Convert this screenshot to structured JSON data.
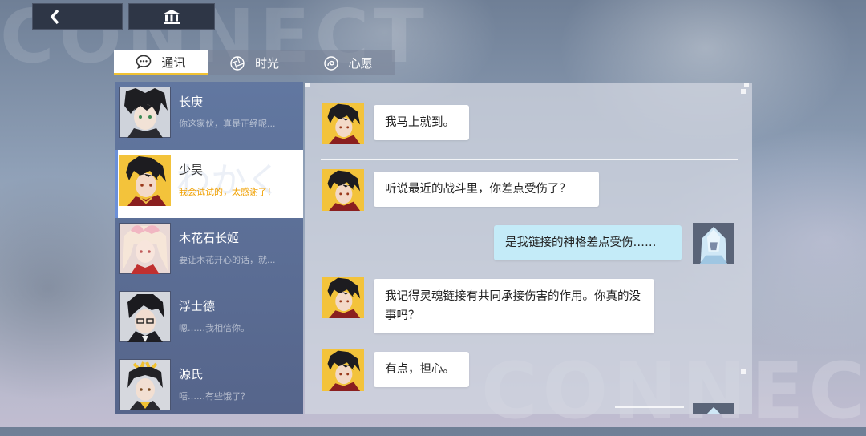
{
  "background": {
    "watermark": "CONNECT"
  },
  "nav": {
    "back_icon": "back-chevron-icon",
    "home_icon": "museum-icon"
  },
  "tabs": [
    {
      "label": "通讯",
      "icon": "chat-bubble-icon",
      "active": true
    },
    {
      "label": "时光",
      "icon": "aperture-icon",
      "active": false
    },
    {
      "label": "心愿",
      "icon": "swirl-icon",
      "active": false
    }
  ],
  "contacts": [
    {
      "name": "长庚",
      "preview": "你这家伙，真是正经呢...",
      "selected": false
    },
    {
      "name": "少昊",
      "preview": "我会试试的，太感谢了！",
      "selected": true
    },
    {
      "name": "木花石长姬",
      "preview": "要让木花开心的话，就...",
      "selected": false
    },
    {
      "name": "浮士德",
      "preview": "嗯……我相信你。",
      "selected": false
    },
    {
      "name": "源氏",
      "preview": "唔……有些饿了？",
      "selected": false
    }
  ],
  "messages": [
    {
      "from": "少昊",
      "text": "我马上就到。"
    },
    {
      "from": "少昊",
      "text": "听说最近的战斗里，你差点受伤了？"
    },
    {
      "from": "self",
      "text": "是我链接的神格差点受伤……"
    },
    {
      "from": "少昊",
      "text": "我记得灵魂链接有共同承接伤害的作用。你真的没事吗？"
    },
    {
      "from": "少昊",
      "text": "有点，担心。"
    }
  ],
  "colors": {
    "accent": "#f1c232",
    "selected_preview": "#f0a000",
    "self_bubble": "#c4ebf8",
    "list_bg": "#6076a0"
  }
}
